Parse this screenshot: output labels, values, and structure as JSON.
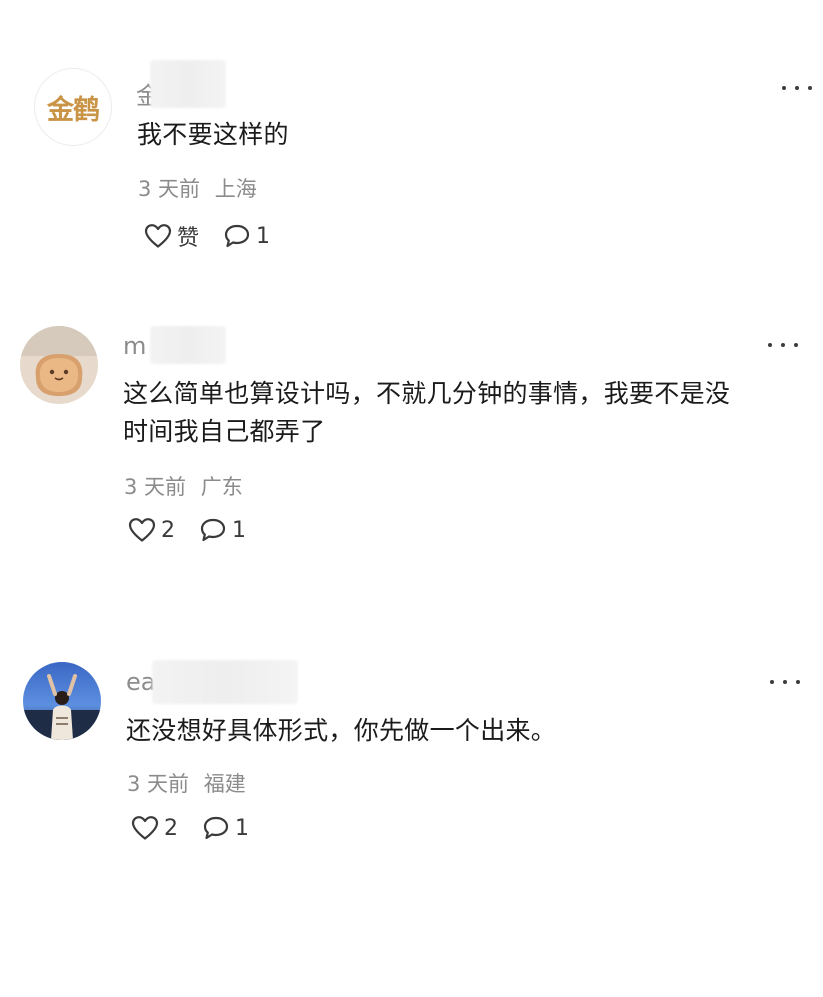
{
  "comments": [
    {
      "avatar_text": "金鹤",
      "username_visible": "金",
      "content": "我不要这样的",
      "time": "3 天前",
      "location": "上海",
      "like_label": "赞",
      "reply_count": "1"
    },
    {
      "username_visible": "m",
      "content_line1": "这么简单也算设计吗，不就几分钟的事情，我要不是没",
      "content_line2": "时间我自己都弄了",
      "time": "3 天前",
      "location": "广东",
      "like_count": "2",
      "reply_count": "1"
    },
    {
      "username_visible": "ea",
      "content": "还没想好具体形式，你先做一个出来。",
      "time": "3 天前",
      "location": "福建",
      "like_count": "2",
      "reply_count": "1"
    }
  ],
  "colors": {
    "brand_gold": "#c99446",
    "meta_gray": "#8b8b8b",
    "text": "#1b1b1b"
  },
  "icons": {
    "more": "more-dots-icon",
    "like": "heart-outline-icon",
    "reply": "comment-bubble-icon"
  }
}
